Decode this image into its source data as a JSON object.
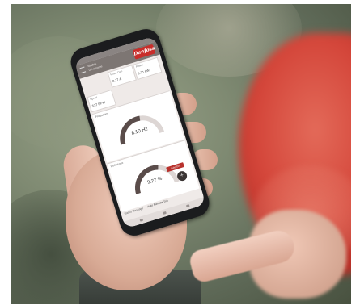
{
  "app": {
    "header_title": "Status",
    "header_subtitle": "Drive name",
    "logo_text": "Danfoss"
  },
  "cards": [
    {
      "label": "Motor Curr.",
      "value": "8.17 A"
    },
    {
      "label": "Power",
      "value": "1.71 kW"
    },
    {
      "label": "Speed",
      "value": "537 RPM"
    }
  ],
  "gauges": [
    {
      "title": "Frequency",
      "value_text": "8.10 Hz",
      "level": 0.55
    },
    {
      "title": "Reference",
      "value_text": "9.27 %",
      "level": 0.6
    }
  ],
  "auto_button_label": "Auto On",
  "fab_symbol": "+",
  "status": {
    "label": "Status Message",
    "value": "Auto Remote Trip"
  },
  "colors": {
    "brand_red": "#c82d2a",
    "gauge_arc": "#5a4c4a",
    "helmet_red": "#d4463a"
  }
}
